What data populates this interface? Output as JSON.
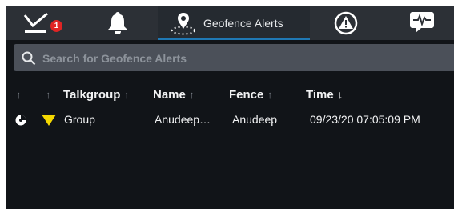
{
  "tabs": {
    "badge_count": "1",
    "active_label": "Geofence Alerts"
  },
  "search": {
    "placeholder": "Search for Geofence Alerts"
  },
  "columns": {
    "sort_up": "↑",
    "talkgroup": "Talkgroup",
    "name": "Name",
    "fence": "Fence",
    "time": "Time",
    "sort_down": "↓"
  },
  "row": {
    "talkgroup": "Group",
    "name": "Anudeep…",
    "fence": "Anudeep",
    "time": "09/23/20 07:05:09 PM"
  },
  "colors": {
    "tab_accent": "#1f78b4",
    "badge": "#e02424",
    "alert_triangle": "#f5d800"
  }
}
